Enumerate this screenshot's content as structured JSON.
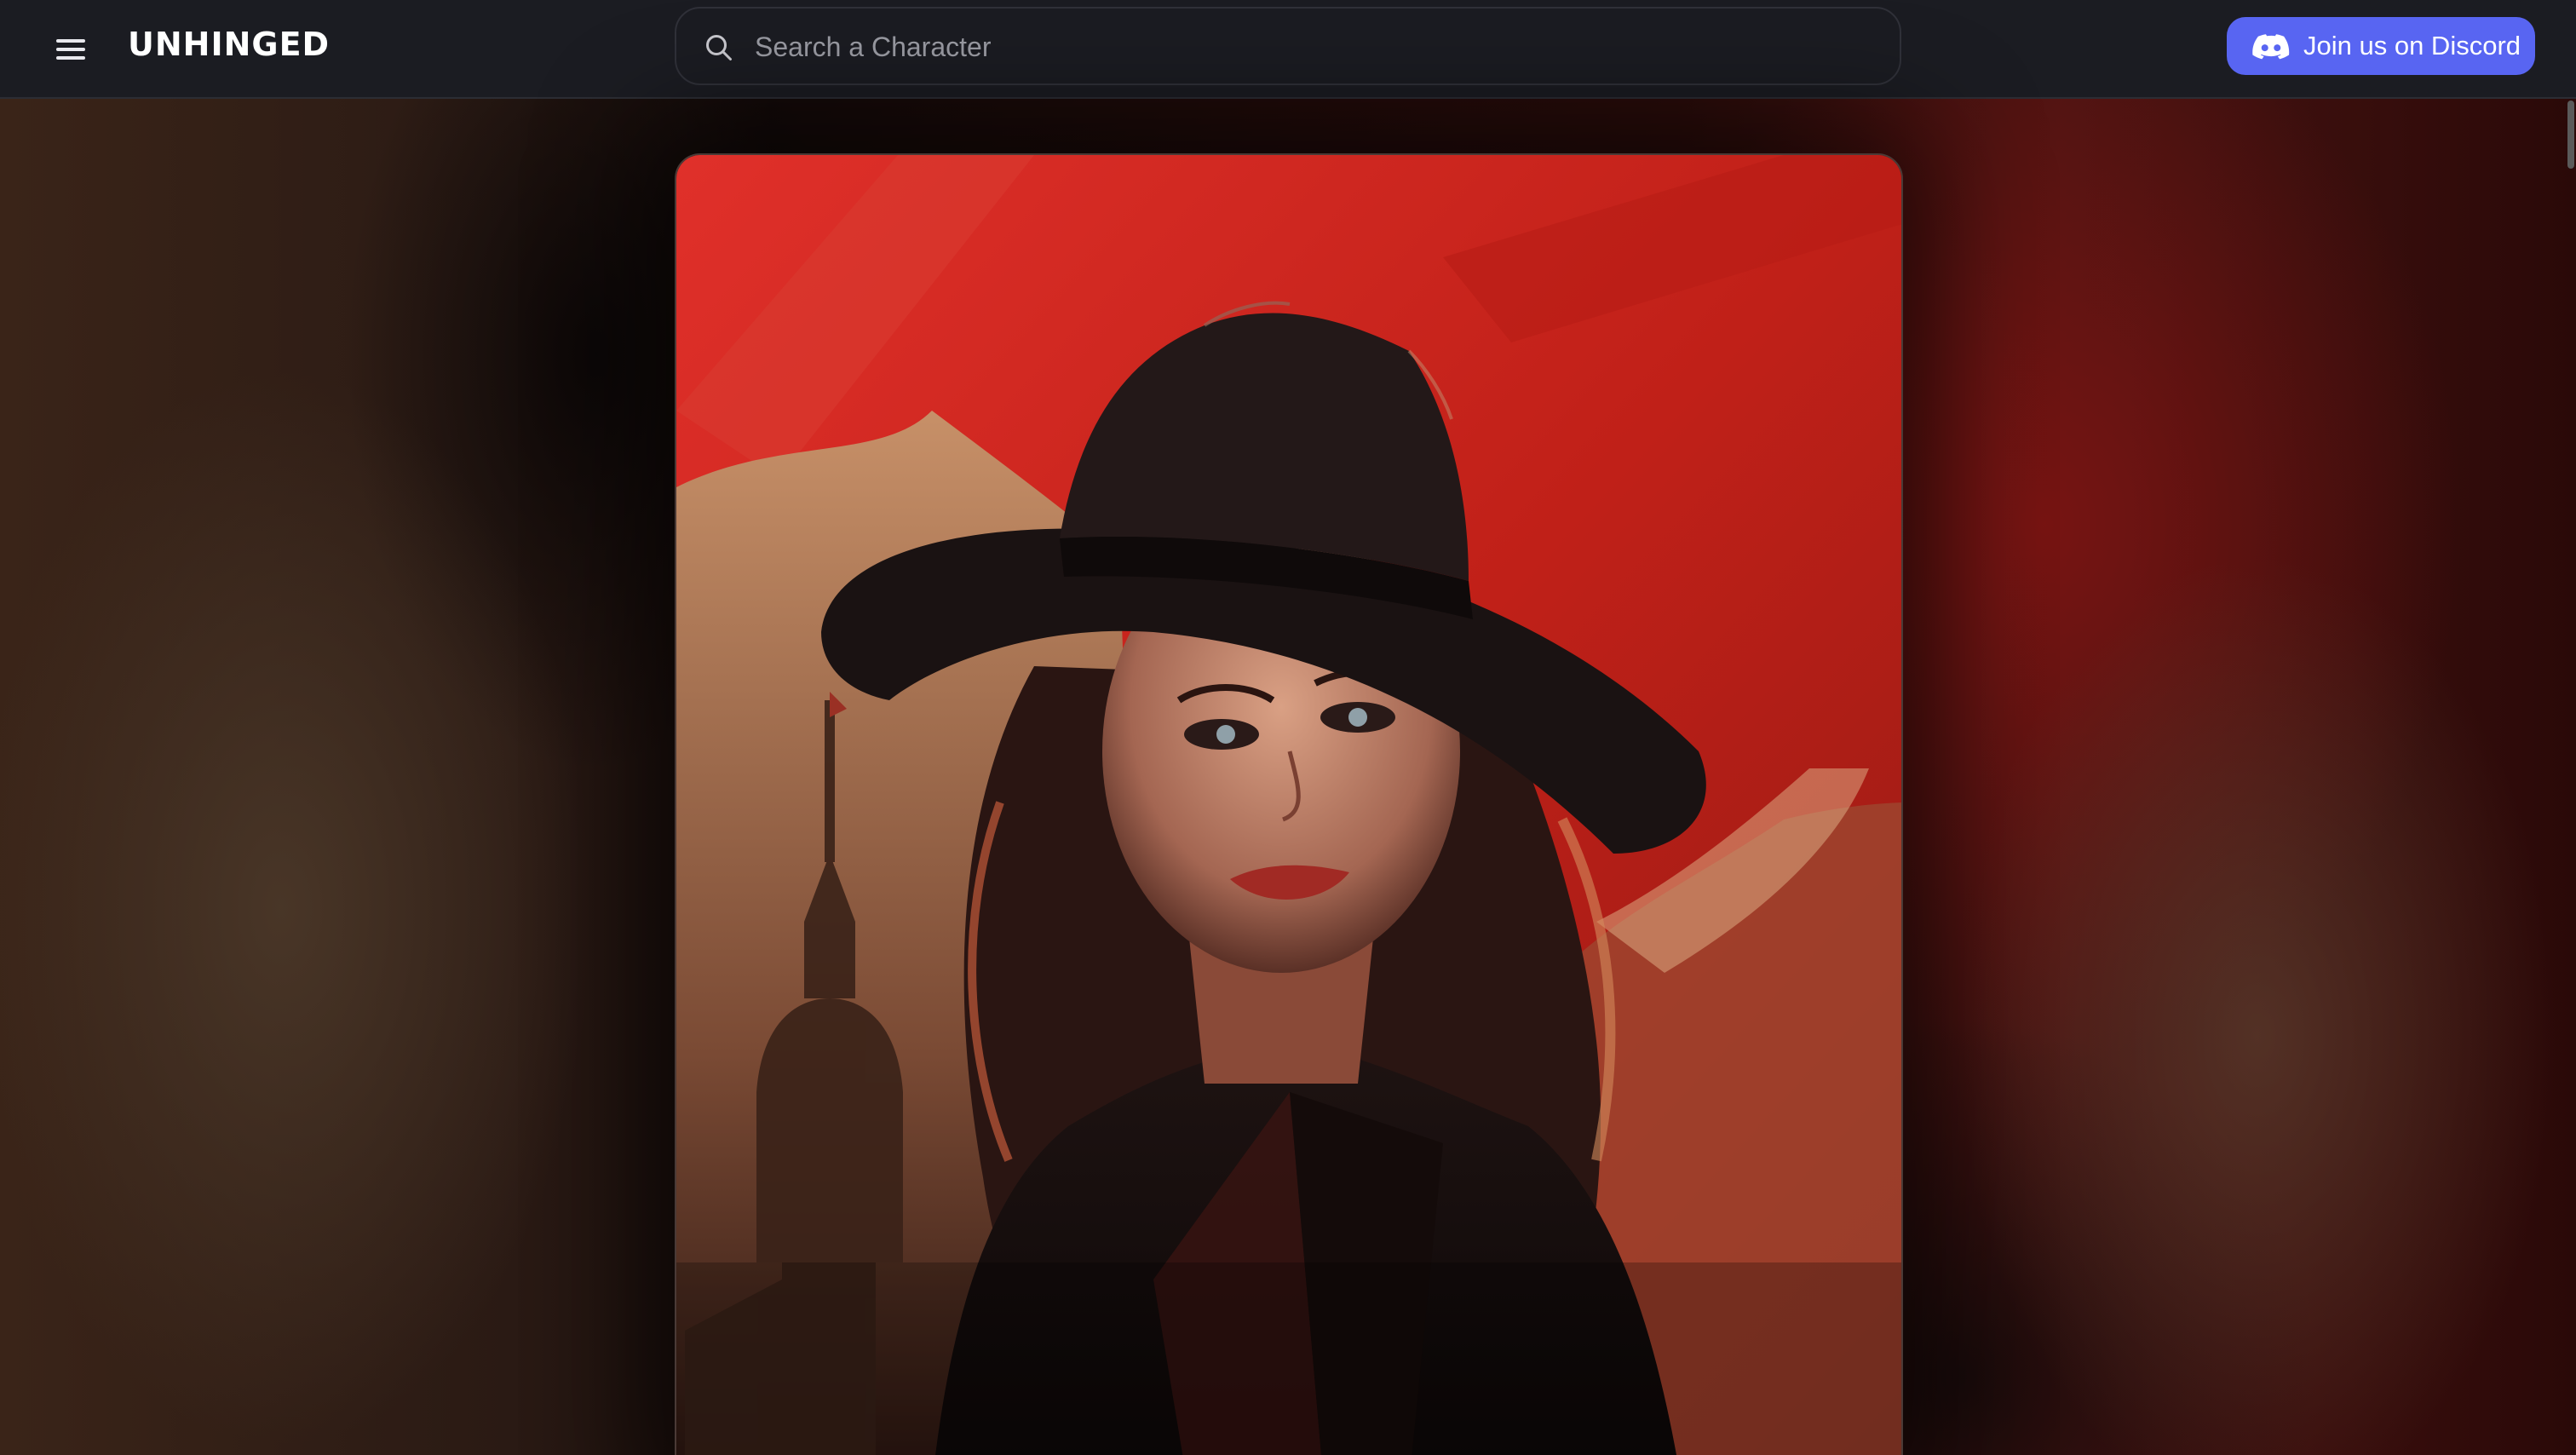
{
  "header": {
    "logo": "UNHINGED",
    "menu_icon": "hamburger-menu-icon",
    "search": {
      "icon": "search-icon",
      "placeholder": "Search a Character",
      "value": ""
    },
    "discord_button": {
      "icon": "discord-icon",
      "label": "Join us on Discord"
    }
  },
  "colors": {
    "topbar": "#1b1c22",
    "accent_discord": "#5865f2",
    "card_red": "#c8241e"
  },
  "main": {
    "character_card": {
      "image": "character-portrait-woman-in-black-hat"
    }
  }
}
